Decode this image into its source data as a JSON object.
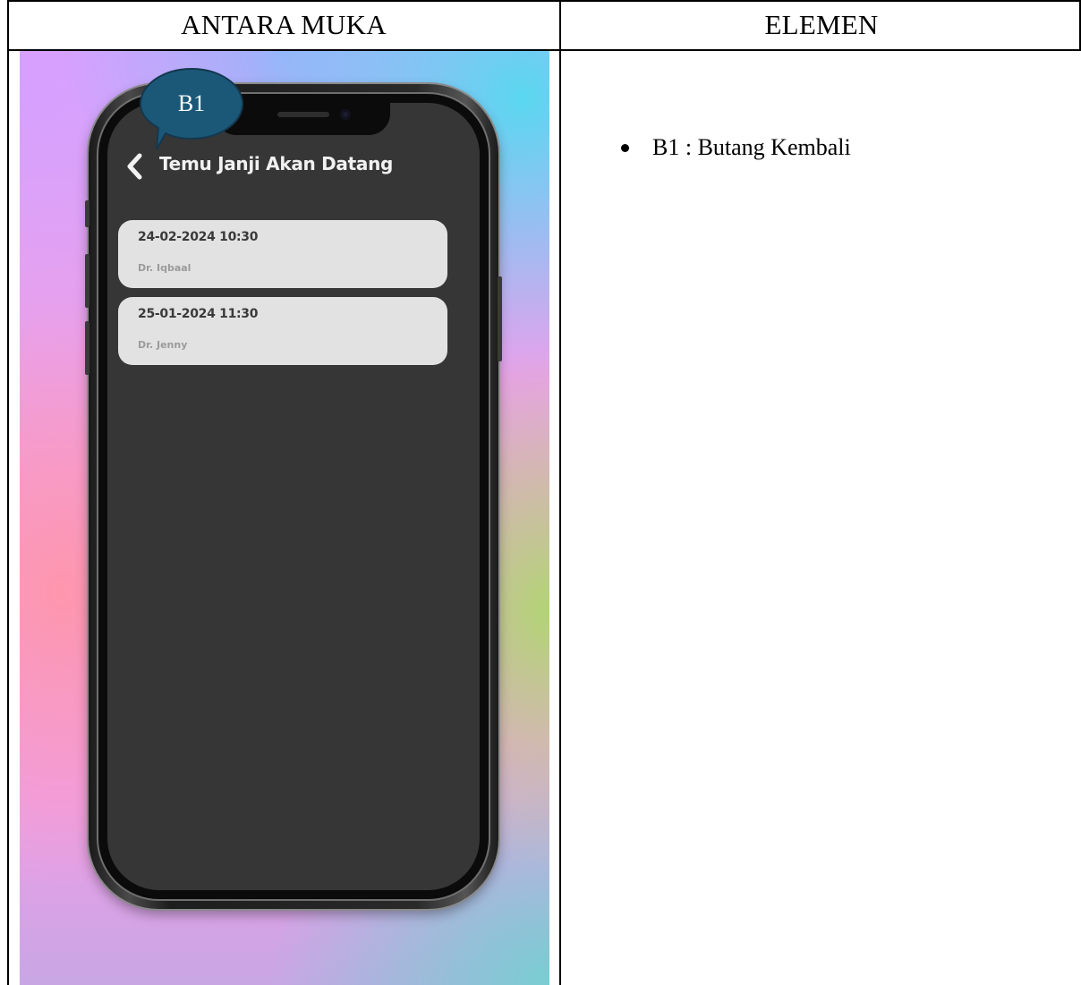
{
  "table": {
    "header_left": "ANTARA MUKA",
    "header_right": "ELEMEN"
  },
  "callout": {
    "label": "B1",
    "color": "#1b5878"
  },
  "app": {
    "title": "Temu Janji Akan Datang",
    "back_icon": "chevron-left-icon",
    "appointments": [
      {
        "datetime": "24-02-2024 10:30",
        "doctor": "Dr. Iqbaal"
      },
      {
        "datetime": "25-01-2024 11:30",
        "doctor": "Dr. Jenny"
      }
    ],
    "screen_color": "#363636",
    "card_color": "#e2e2e2"
  },
  "elements": [
    {
      "text": "B1 : Butang Kembali"
    }
  ]
}
